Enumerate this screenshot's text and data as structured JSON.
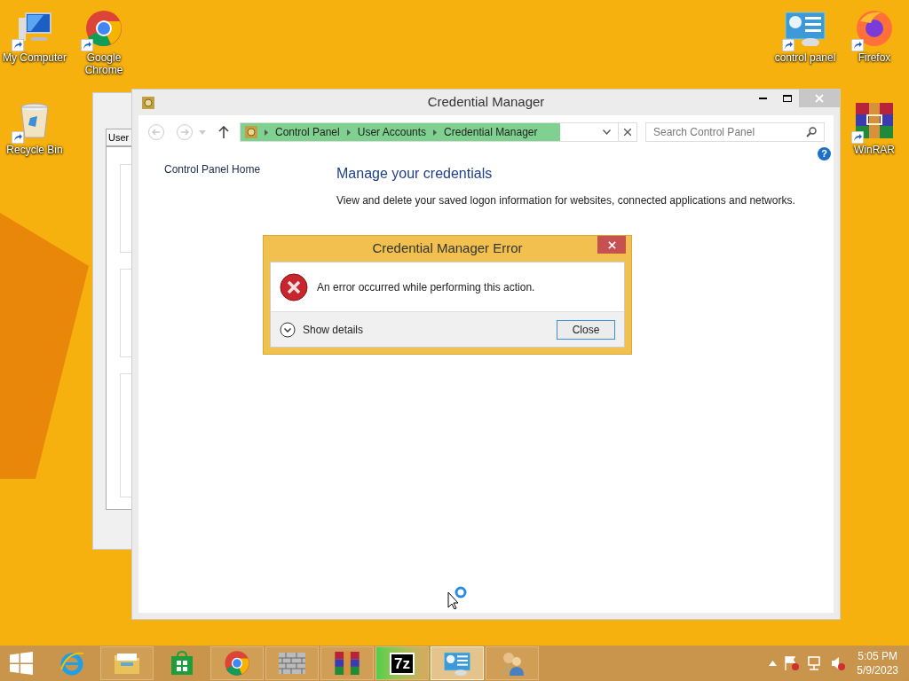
{
  "desktop_icons": [
    {
      "label": "My Computer",
      "kind": "computer"
    },
    {
      "label": "Google Chrome",
      "kind": "chrome"
    },
    {
      "label": "control panel",
      "kind": "controlpanel"
    },
    {
      "label": "Firefox",
      "kind": "firefox"
    },
    {
      "label": "Recycle Bin",
      "kind": "bin"
    },
    {
      "label": "WinRAR",
      "kind": "winrar"
    }
  ],
  "background_window": {
    "tab": "User"
  },
  "window": {
    "title": "Credential Manager",
    "breadcrumb": [
      "Control Panel",
      "User Accounts",
      "Credential Manager"
    ],
    "search": {
      "placeholder": "Search Control Panel"
    },
    "help": "?",
    "sidebar": [
      "Control Panel Home"
    ],
    "heading": "Manage your credentials",
    "description": "View and delete your saved logon information for websites, connected applications and networks."
  },
  "dialog": {
    "title": "Credential Manager Error",
    "message": "An error occurred while performing this action.",
    "details_toggle": "Show details",
    "buttons": [
      "Close"
    ]
  },
  "taskbar": {
    "apps": [
      {
        "kind": "ie",
        "running": false,
        "selected": false
      },
      {
        "kind": "explorer",
        "running": true,
        "selected": false
      },
      {
        "kind": "store",
        "running": false,
        "selected": false
      },
      {
        "kind": "chrome",
        "running": true,
        "selected": false
      },
      {
        "kind": "firewall",
        "running": true,
        "selected": false
      },
      {
        "kind": "winrar",
        "running": true,
        "selected": false
      },
      {
        "kind": "sevenzip",
        "running": true,
        "selected": false,
        "label": "7z"
      },
      {
        "kind": "controlpanel",
        "running": true,
        "selected": true
      },
      {
        "kind": "users",
        "running": true,
        "selected": false
      }
    ],
    "clock": {
      "time": "5:05 PM",
      "date": "5/9/2023"
    }
  }
}
